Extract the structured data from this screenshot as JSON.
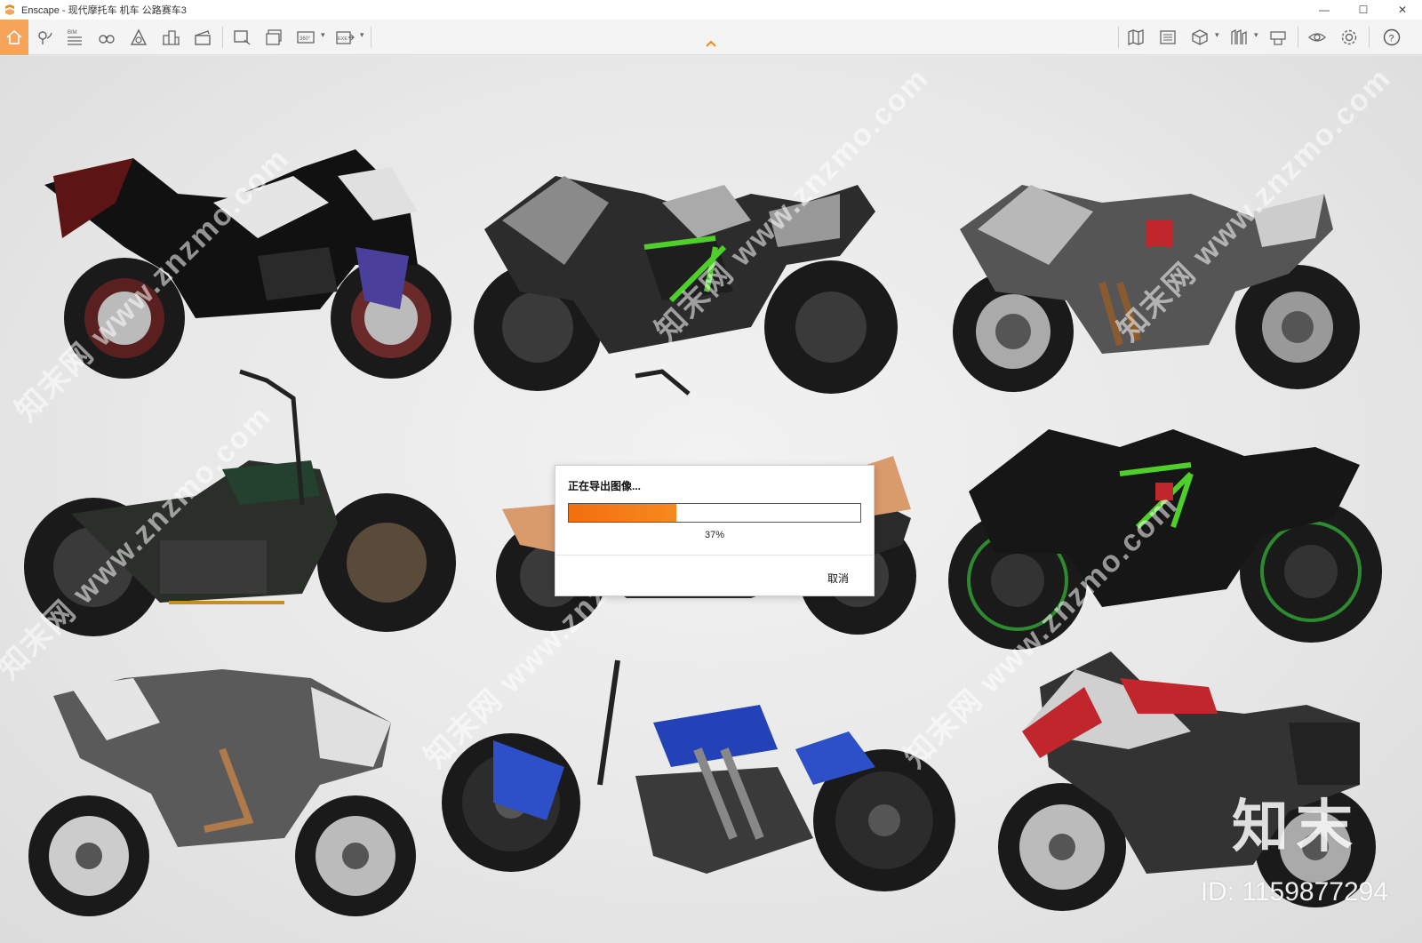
{
  "window": {
    "title": "Enscape - 现代摩托车 机车 公路赛车3",
    "minimize": "—",
    "maximize": "☐",
    "close": "✕"
  },
  "colors": {
    "accent": "#f6a45a",
    "progress": "#f26f0e"
  },
  "toolbar": {
    "bim_label": "BIM",
    "panorama_label": "360°",
    "exe_label": "EXE",
    "icons": [
      "home-icon",
      "map-pin-icon",
      "bim-icon",
      "binoculars-icon",
      "atmosphere-icon",
      "buildings-icon",
      "clapperboard-icon",
      "screenshot-icon",
      "batch-render-icon",
      "panorama-icon",
      "export-exe-icon",
      "map-icon",
      "views-icon",
      "cube-icon",
      "asset-library-icon",
      "material-editor-icon",
      "visibility-icon",
      "settings-icon",
      "help-icon"
    ]
  },
  "dialog": {
    "title": "正在导出图像...",
    "progress_percent": 37,
    "progress_text": "37%",
    "cancel_label": "取消"
  },
  "watermark": {
    "diagonal_text": "知末网 www.znzmo.com",
    "brand": "知末",
    "id_text": "ID: 1159877294"
  }
}
